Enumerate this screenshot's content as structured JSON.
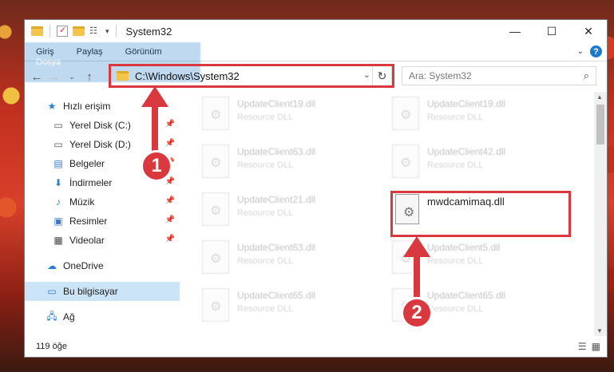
{
  "window": {
    "title": "System32",
    "controls": {
      "minimize": "—",
      "maximize": "☐",
      "close": "✕"
    }
  },
  "ribbon": {
    "tabs": [
      "Dosya",
      "Giriş",
      "Paylaş",
      "Görünüm"
    ],
    "help": "?"
  },
  "address": {
    "path": "C:\\Windows\\System32"
  },
  "search": {
    "placeholder": "Ara: System32"
  },
  "sidebar": {
    "items": [
      {
        "label": "Hızlı erişim",
        "icon": "star-icon"
      },
      {
        "label": "Yerel Disk (C:)",
        "icon": "drive-icon"
      },
      {
        "label": "Yerel Disk (D:)",
        "icon": "drive-icon"
      },
      {
        "label": "Belgeler",
        "icon": "documents-icon"
      },
      {
        "label": "İndirmeler",
        "icon": "downloads-icon"
      },
      {
        "label": "Müzik",
        "icon": "music-icon"
      },
      {
        "label": "Resimler",
        "icon": "pictures-icon"
      },
      {
        "label": "Videolar",
        "icon": "videos-icon"
      },
      {
        "label": "OneDrive",
        "icon": "cloud-icon"
      },
      {
        "label": "Bu bilgisayar",
        "icon": "computer-icon"
      },
      {
        "label": "Ağ",
        "icon": "network-icon"
      }
    ]
  },
  "files": [
    {
      "name": "UpdateClient19.dll",
      "desc": "Resource DLL"
    },
    {
      "name": "UpdateClient19.dll",
      "desc": "Resource DLL"
    },
    {
      "name": "UpdateClient63.dll",
      "desc": "Resource DLL"
    },
    {
      "name": "UpdateClient42.dll",
      "desc": "Resource DLL"
    },
    {
      "name": "UpdateClient21.dll",
      "desc": "Resource DLL"
    },
    {
      "name": "mwdcamimaq.dll",
      "desc": ""
    },
    {
      "name": "UpdateClient63.dll",
      "desc": "Resource DLL"
    },
    {
      "name": "UpdateClient5.dll",
      "desc": "Resource DLL"
    },
    {
      "name": "UpdateClient65.dll",
      "desc": "Resource DLL"
    },
    {
      "name": "UpdateClient65.dll",
      "desc": "Resource DLL"
    }
  ],
  "status": {
    "count": "119 öğe"
  },
  "annotations": {
    "badge1": "1",
    "badge2": "2",
    "color": "#d9383e"
  }
}
